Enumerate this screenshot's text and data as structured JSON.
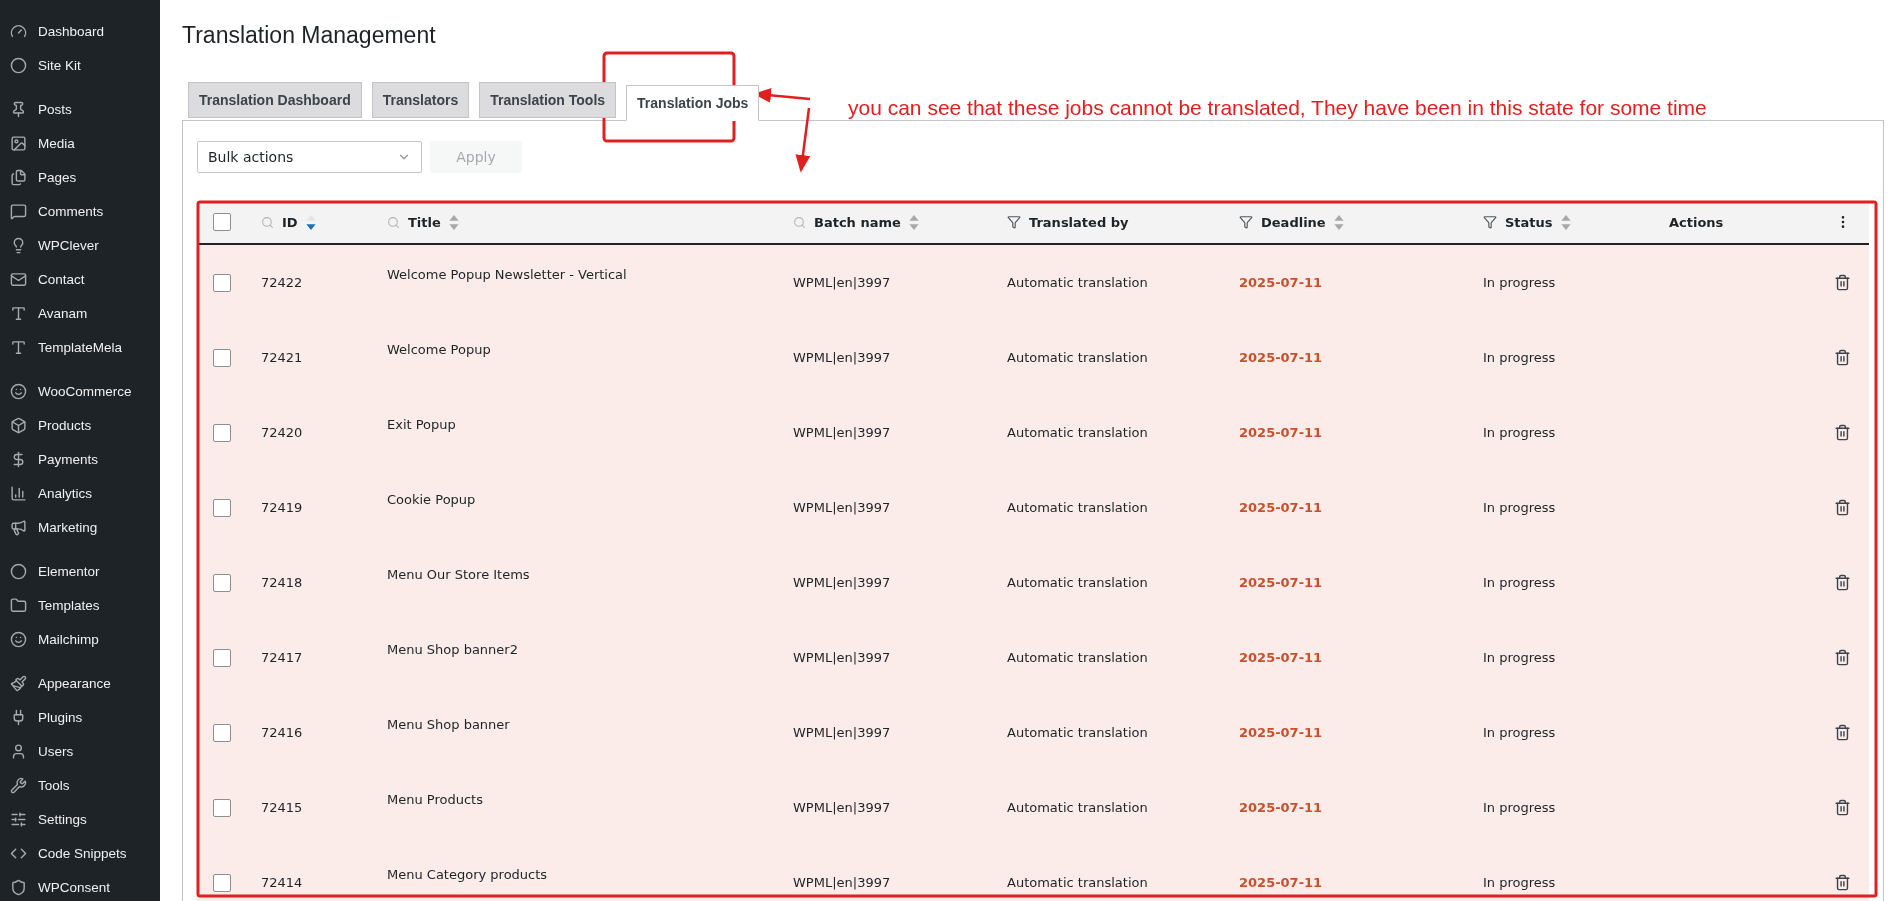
{
  "sidebar": {
    "groups": [
      [
        {
          "label": "Dashboard"
        },
        {
          "label": "Site Kit"
        }
      ],
      [
        {
          "label": "Posts"
        },
        {
          "label": "Media"
        },
        {
          "label": "Pages"
        },
        {
          "label": "Comments"
        },
        {
          "label": "WPClever"
        },
        {
          "label": "Contact"
        },
        {
          "label": "Avanam"
        },
        {
          "label": "TemplateMela"
        }
      ],
      [
        {
          "label": "WooCommerce"
        },
        {
          "label": "Products"
        },
        {
          "label": "Payments"
        },
        {
          "label": "Analytics"
        },
        {
          "label": "Marketing"
        }
      ],
      [
        {
          "label": "Elementor"
        },
        {
          "label": "Templates"
        },
        {
          "label": "Mailchimp"
        }
      ],
      [
        {
          "label": "Appearance"
        },
        {
          "label": "Plugins"
        },
        {
          "label": "Users"
        },
        {
          "label": "Tools"
        },
        {
          "label": "Settings"
        },
        {
          "label": "Code Snippets"
        },
        {
          "label": "WPConsent"
        }
      ]
    ]
  },
  "page": {
    "title": "Translation Management"
  },
  "tabs": [
    {
      "label": "Translation Dashboard",
      "selected": false
    },
    {
      "label": "Translators",
      "selected": false
    },
    {
      "label": "Translation Tools",
      "selected": false
    },
    {
      "label": "Translation Jobs",
      "selected": true
    }
  ],
  "toolbar": {
    "bulk_select": {
      "value": "Bulk actions"
    },
    "apply_button": {
      "label": "Apply",
      "disabled": true
    }
  },
  "table": {
    "select_all": {
      "checked": false
    },
    "columns": [
      {
        "label": "ID",
        "kind": "search",
        "sorted": true
      },
      {
        "label": "Title",
        "kind": "search",
        "sorted": false
      },
      {
        "label": "Batch name",
        "kind": "search",
        "sorted": false
      },
      {
        "label": "Translated by",
        "kind": "filter"
      },
      {
        "label": "Deadline",
        "kind": "filter",
        "sorted": false
      },
      {
        "label": "Status",
        "kind": "filter",
        "sorted": false
      },
      {
        "label": "Actions",
        "kind": "plain"
      }
    ],
    "rows": [
      {
        "checked": false,
        "id": "72422",
        "title": "Welcome Popup Newsletter - Vertical",
        "batch": "WPML|en|3997",
        "translated_by": "Automatic translation",
        "deadline": "2025-07-11",
        "overdue": true,
        "status": "In progress"
      },
      {
        "checked": false,
        "id": "72421",
        "title": "Welcome Popup",
        "batch": "WPML|en|3997",
        "translated_by": "Automatic translation",
        "deadline": "2025-07-11",
        "overdue": true,
        "status": "In progress"
      },
      {
        "checked": false,
        "id": "72420",
        "title": "Exit Popup",
        "batch": "WPML|en|3997",
        "translated_by": "Automatic translation",
        "deadline": "2025-07-11",
        "overdue": true,
        "status": "In progress"
      },
      {
        "checked": false,
        "id": "72419",
        "title": "Cookie Popup",
        "batch": "WPML|en|3997",
        "translated_by": "Automatic translation",
        "deadline": "2025-07-11",
        "overdue": true,
        "status": "In progress"
      },
      {
        "checked": false,
        "id": "72418",
        "title": "Menu Our Store Items",
        "batch": "WPML|en|3997",
        "translated_by": "Automatic translation",
        "deadline": "2025-07-11",
        "overdue": true,
        "status": "In progress"
      },
      {
        "checked": false,
        "id": "72417",
        "title": "Menu Shop banner2",
        "batch": "WPML|en|3997",
        "translated_by": "Automatic translation",
        "deadline": "2025-07-11",
        "overdue": true,
        "status": "In progress"
      },
      {
        "checked": false,
        "id": "72416",
        "title": "Menu Shop banner",
        "batch": "WPML|en|3997",
        "translated_by": "Automatic translation",
        "deadline": "2025-07-11",
        "overdue": true,
        "status": "In progress"
      },
      {
        "checked": false,
        "id": "72415",
        "title": "Menu Products",
        "batch": "WPML|en|3997",
        "translated_by": "Automatic translation",
        "deadline": "2025-07-11",
        "overdue": true,
        "status": "In progress"
      },
      {
        "checked": false,
        "id": "72414",
        "title": "Menu Category products",
        "batch": "WPML|en|3997",
        "translated_by": "Automatic translation",
        "deadline": "2025-07-11",
        "overdue": true,
        "status": "In progress"
      }
    ]
  },
  "annotation": {
    "note": "you can see that these jobs cannot be translated, They have been in this state for some time"
  }
}
